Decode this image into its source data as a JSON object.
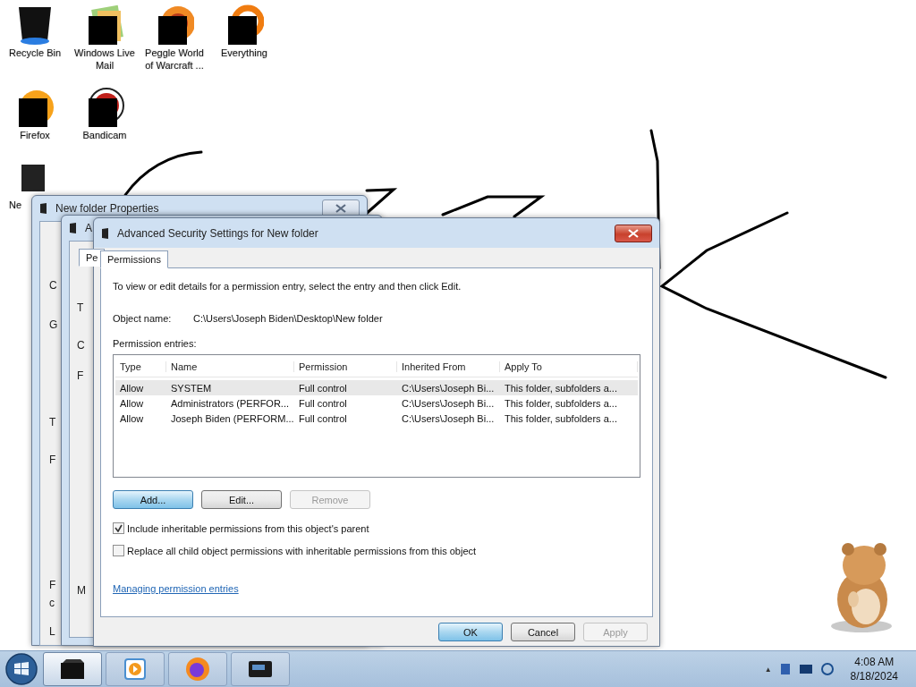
{
  "desktop_icons": [
    {
      "label": "Recycle Bin",
      "kind": "bin"
    },
    {
      "label": "Windows Live Mail",
      "kind": "mail"
    },
    {
      "label": "Peggle World of Warcraft ...",
      "kind": "game"
    },
    {
      "label": "Everything",
      "kind": "ring"
    },
    {
      "label": "Firefox",
      "kind": "fox"
    },
    {
      "label": "Bandicam",
      "kind": "record"
    },
    {
      "label": "Ne",
      "kind": "folder"
    }
  ],
  "back_window": {
    "title": "New folder Properties",
    "fragments": [
      "C",
      "G",
      "T",
      "F",
      "F",
      "c",
      "L"
    ]
  },
  "middle_window": {
    "title": "A",
    "tab": "Pe",
    "fragments": [
      "T",
      "C",
      "F",
      "M"
    ]
  },
  "dialog": {
    "title": "Advanced Security Settings for New folder",
    "tabs": [
      {
        "label": "Permissions",
        "selected": true
      }
    ],
    "intro": "To view or edit details for a permission entry, select the entry and then click Edit.",
    "object_name_label": "Object name:",
    "object_name": "C:\\Users\\Joseph Biden\\Desktop\\New folder",
    "entries_label": "Permission entries:",
    "table": {
      "columns": [
        "Type",
        "Name",
        "Permission",
        "Inherited From",
        "Apply To"
      ],
      "rows": [
        {
          "cells": [
            "Allow",
            "SYSTEM",
            "Full control",
            "C:\\Users\\Joseph Bi...",
            "This folder, subfolders a..."
          ],
          "selected": true
        },
        {
          "cells": [
            "Allow",
            "Administrators (PERFOR...",
            "Full control",
            "C:\\Users\\Joseph Bi...",
            "This folder, subfolders a..."
          ],
          "selected": false
        },
        {
          "cells": [
            "Allow",
            "Joseph Biden (PERFORM...",
            "Full control",
            "C:\\Users\\Joseph Bi...",
            "This folder, subfolders a..."
          ],
          "selected": false
        }
      ]
    },
    "entry_buttons": [
      {
        "label": "Add...",
        "default": true,
        "disabled": false
      },
      {
        "label": "Edit...",
        "default": false,
        "disabled": false
      },
      {
        "label": "Remove",
        "default": false,
        "disabled": true
      }
    ],
    "checkboxes": [
      {
        "label": "Include inheritable permissions from this object's parent",
        "checked": true
      },
      {
        "label": "Replace all child object permissions with inheritable permissions from this object",
        "checked": false
      }
    ],
    "help_link": "Managing permission entries",
    "footer_buttons": [
      {
        "label": "OK",
        "default": true,
        "disabled": false
      },
      {
        "label": "Cancel",
        "default": false,
        "disabled": false
      },
      {
        "label": "Apply",
        "default": false,
        "disabled": true
      }
    ]
  },
  "taskbar": {
    "items": [
      {
        "kind": "explorer",
        "selected": true
      },
      {
        "kind": "media",
        "selected": false
      },
      {
        "kind": "firefox",
        "selected": false
      },
      {
        "kind": "monitor",
        "selected": false
      }
    ],
    "tray": {
      "show_hidden": "▲",
      "time": "4:08 AM",
      "date": "8/18/2024"
    }
  }
}
